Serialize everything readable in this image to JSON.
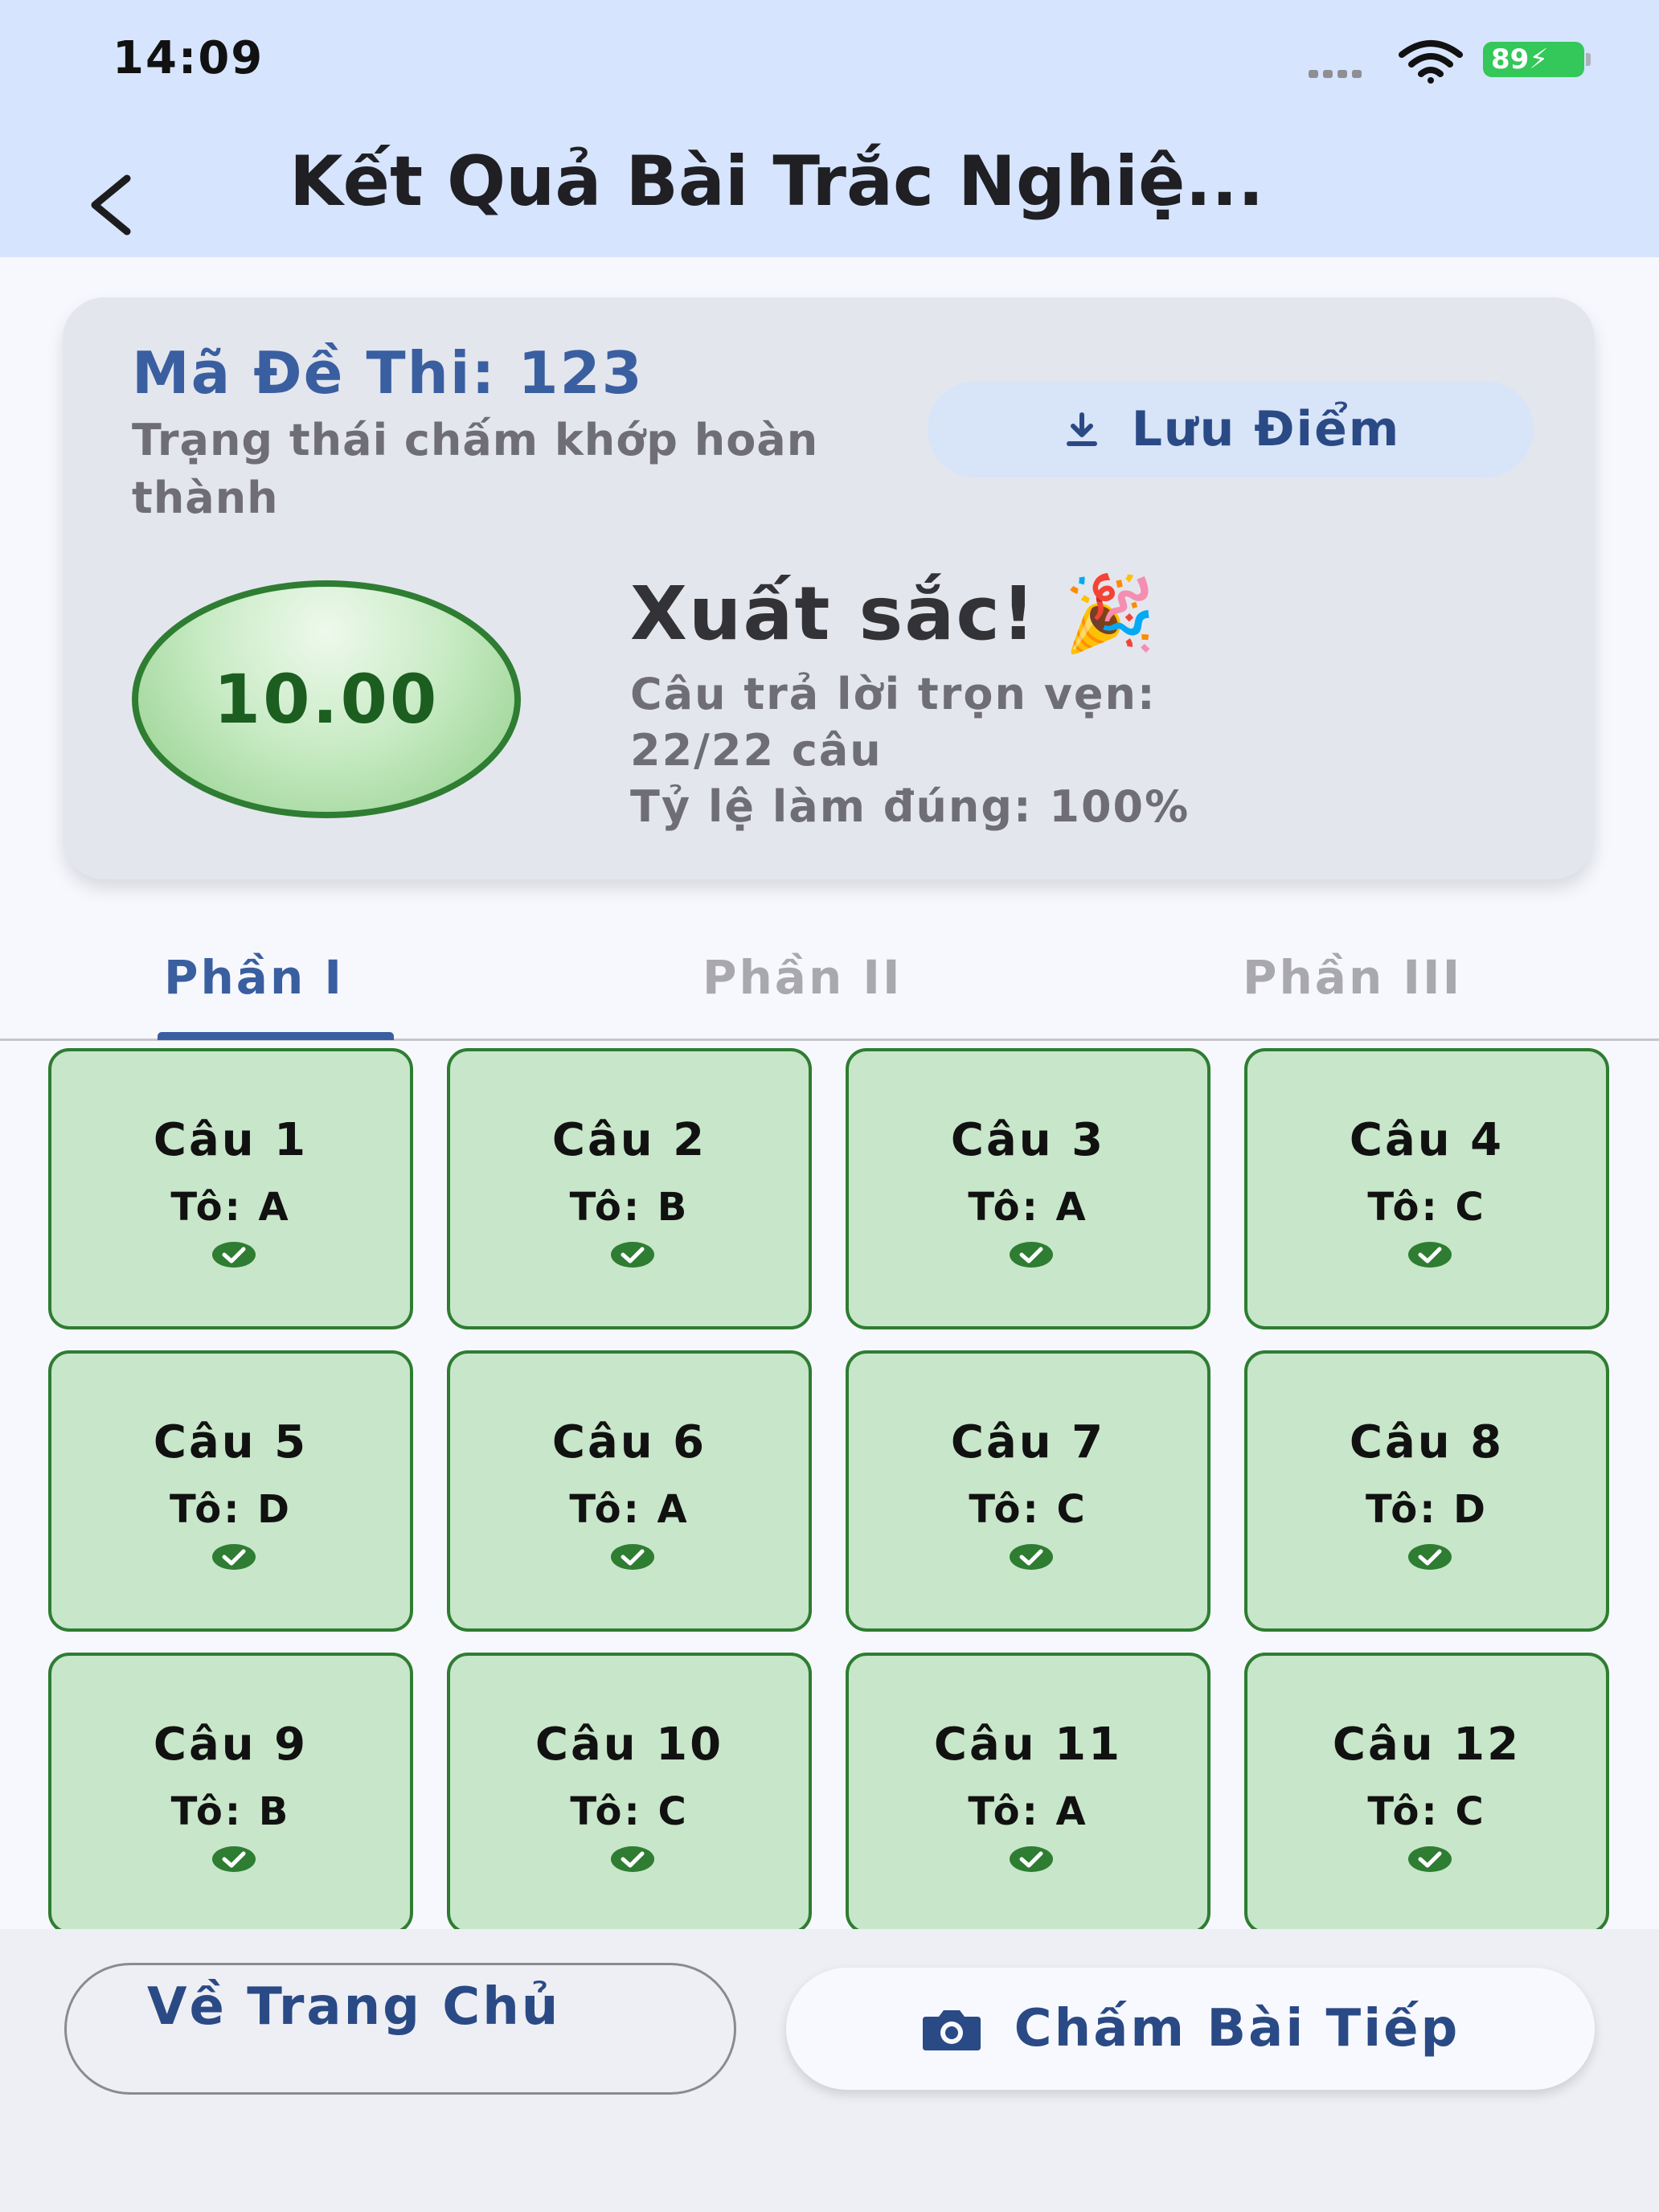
{
  "status_bar": {
    "time": "14:09",
    "battery": "89"
  },
  "header": {
    "title": "Kết Quả Bài Trắc Nghiệ..."
  },
  "summary": {
    "exam_code": "Mã Đề Thi: 123",
    "status": "Trạng thái chấm khớp hoàn thành",
    "save_label": "Lưu Điểm",
    "score": "10.00",
    "verdict": "Xuất sắc! 🎉",
    "complete_answers_label": "Câu trả lời trọn vẹn:",
    "complete_answers_value": "22/22 câu",
    "accuracy": "Tỷ lệ làm đúng: 100%"
  },
  "tabs": [
    {
      "label": "Phần I",
      "active": true
    },
    {
      "label": "Phần II",
      "active": false
    },
    {
      "label": "Phần III",
      "active": false
    }
  ],
  "answers": [
    {
      "question": "Câu 1",
      "answer": "Tô: A",
      "correct": true
    },
    {
      "question": "Câu 2",
      "answer": "Tô: B",
      "correct": true
    },
    {
      "question": "Câu 3",
      "answer": "Tô: A",
      "correct": true
    },
    {
      "question": "Câu 4",
      "answer": "Tô: C",
      "correct": true
    },
    {
      "question": "Câu 5",
      "answer": "Tô: D",
      "correct": true
    },
    {
      "question": "Câu 6",
      "answer": "Tô: A",
      "correct": true
    },
    {
      "question": "Câu 7",
      "answer": "Tô: C",
      "correct": true
    },
    {
      "question": "Câu 8",
      "answer": "Tô: D",
      "correct": true
    },
    {
      "question": "Câu 9",
      "answer": "Tô: B",
      "correct": true
    },
    {
      "question": "Câu 10",
      "answer": "Tô: C",
      "correct": true
    },
    {
      "question": "Câu 11",
      "answer": "Tô: A",
      "correct": true
    },
    {
      "question": "Câu 12",
      "answer": "Tô: C",
      "correct": true
    }
  ],
  "bottom": {
    "home_label": "Về Trang Chủ",
    "next_label": "Chấm Bài Tiếp"
  },
  "icons": {
    "back": "chevron-left-icon",
    "save": "download-icon",
    "correct": "check-circle-icon",
    "camera": "camera-icon",
    "celebration": "party-popper-emoji"
  },
  "colors": {
    "header_bg": "#d6e4fd",
    "accent": "#3a5fa0",
    "correct_fill": "#c8e6c9",
    "correct_border": "#2e7d32"
  }
}
